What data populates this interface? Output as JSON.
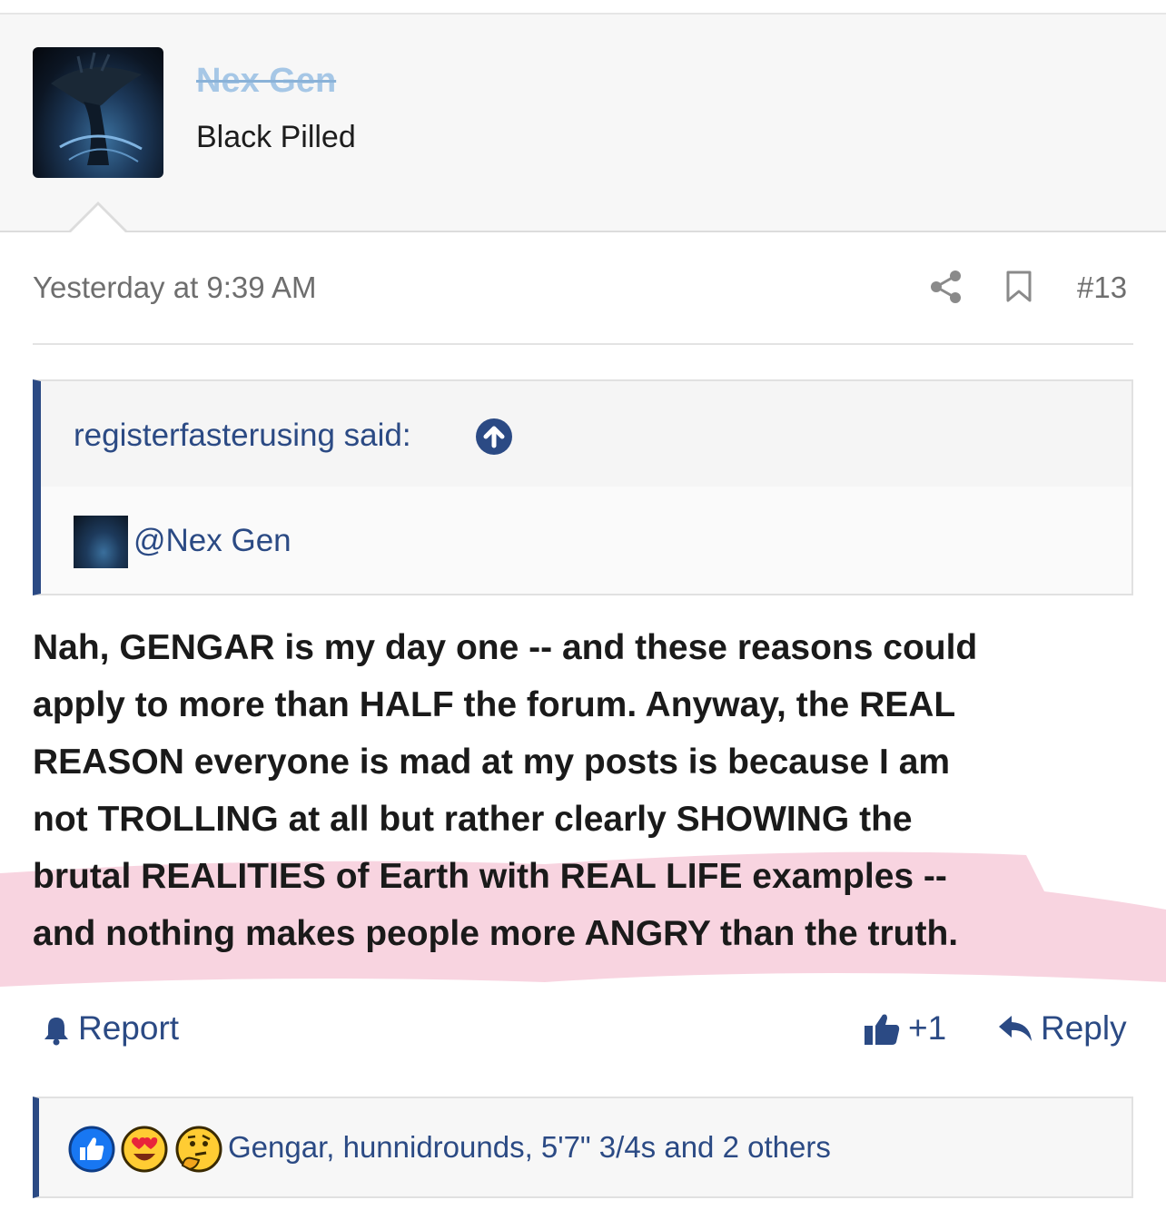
{
  "post": {
    "username": "Nex Gen",
    "user_title": "Black Pilled",
    "timestamp": "Yesterday at 9:39 AM",
    "post_number": "#13"
  },
  "quote": {
    "author_line": "registerfasterusing said:",
    "mention": "@Nex Gen"
  },
  "message": {
    "lines": [
      "Nah, GENGAR is my day one -- and these reasons could",
      "apply to more than HALF the forum. Anyway, the REAL",
      "REASON everyone is mad at my posts is because I am",
      "not TROLLING at all but rather clearly SHOWING the",
      "brutal REALITIES of Earth with REAL LIFE examples --",
      "and nothing makes people more ANGRY than the truth."
    ]
  },
  "actions": {
    "report_label": "Report",
    "like_count": "+1",
    "reply_label": "Reply"
  },
  "reactions": {
    "icons": [
      "like-reaction-icon",
      "love-reaction-icon",
      "thinking-reaction-icon"
    ],
    "users_text": "Gengar, hunnidrounds, 5'7\" 3/4s and 2 others"
  },
  "colors": {
    "link_blue": "#2b4a84",
    "username_strike": "#a6c7e6",
    "highlight_pink": "#f4b8cb"
  }
}
